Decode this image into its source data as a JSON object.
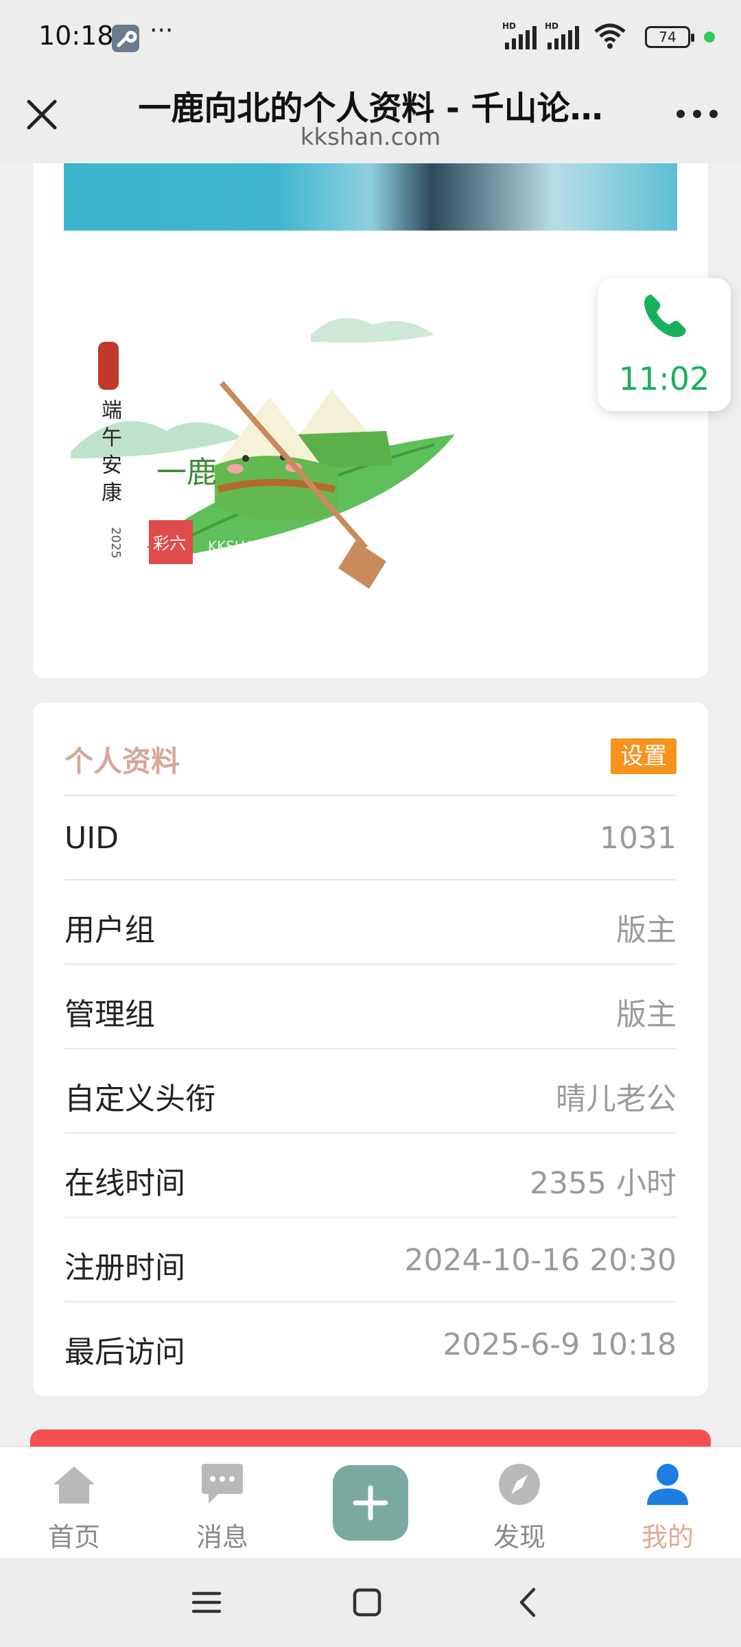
{
  "status_bar": {
    "time": "10:18",
    "dots": "···",
    "battery": "74",
    "icons": [
      "wrench-icon",
      "hd-signal-icon",
      "hd-signal-icon",
      "wifi-icon",
      "battery-icon"
    ]
  },
  "title_bar": {
    "title": "一鹿向北的个人资料 - 千山论…",
    "domain": "kkshan.com"
  },
  "festival_image": {
    "text_lines": [
      "端",
      "午",
      "安",
      "康"
    ],
    "year": "2025",
    "name": "一鹿",
    "watermark": "KKSHAN.COM/",
    "seal": "彩六"
  },
  "call_widget": {
    "time": "11:02",
    "color": "#18b15b"
  },
  "profile": {
    "title": "个人资料",
    "settings_label": "设置",
    "rows": [
      {
        "label": "UID",
        "value": "1031"
      },
      {
        "label": "用户组",
        "value": "版主"
      },
      {
        "label": "管理组",
        "value": "版主"
      },
      {
        "label": "自定义头衔",
        "value": "晴儿老公"
      },
      {
        "label": "在线时间",
        "value": "2355 小时"
      },
      {
        "label": "注册时间",
        "value": "2024-10-16 20:30"
      },
      {
        "label": "最后访问",
        "value": "2025-6-9 10:18"
      }
    ]
  },
  "bottom_nav": {
    "items": [
      {
        "label": "首页",
        "icon": "home-icon"
      },
      {
        "label": "消息",
        "icon": "message-icon"
      },
      {
        "label": "",
        "icon": "plus-icon"
      },
      {
        "label": "发现",
        "icon": "compass-icon"
      },
      {
        "label": "我的",
        "icon": "user-icon",
        "active": true
      }
    ]
  },
  "colors": {
    "accent_orange": "#f7931e",
    "profile_title": "#d6a89a",
    "red_bar": "#f5504f",
    "add_button": "#7aaa9f",
    "user_active": "#1e7de0"
  }
}
